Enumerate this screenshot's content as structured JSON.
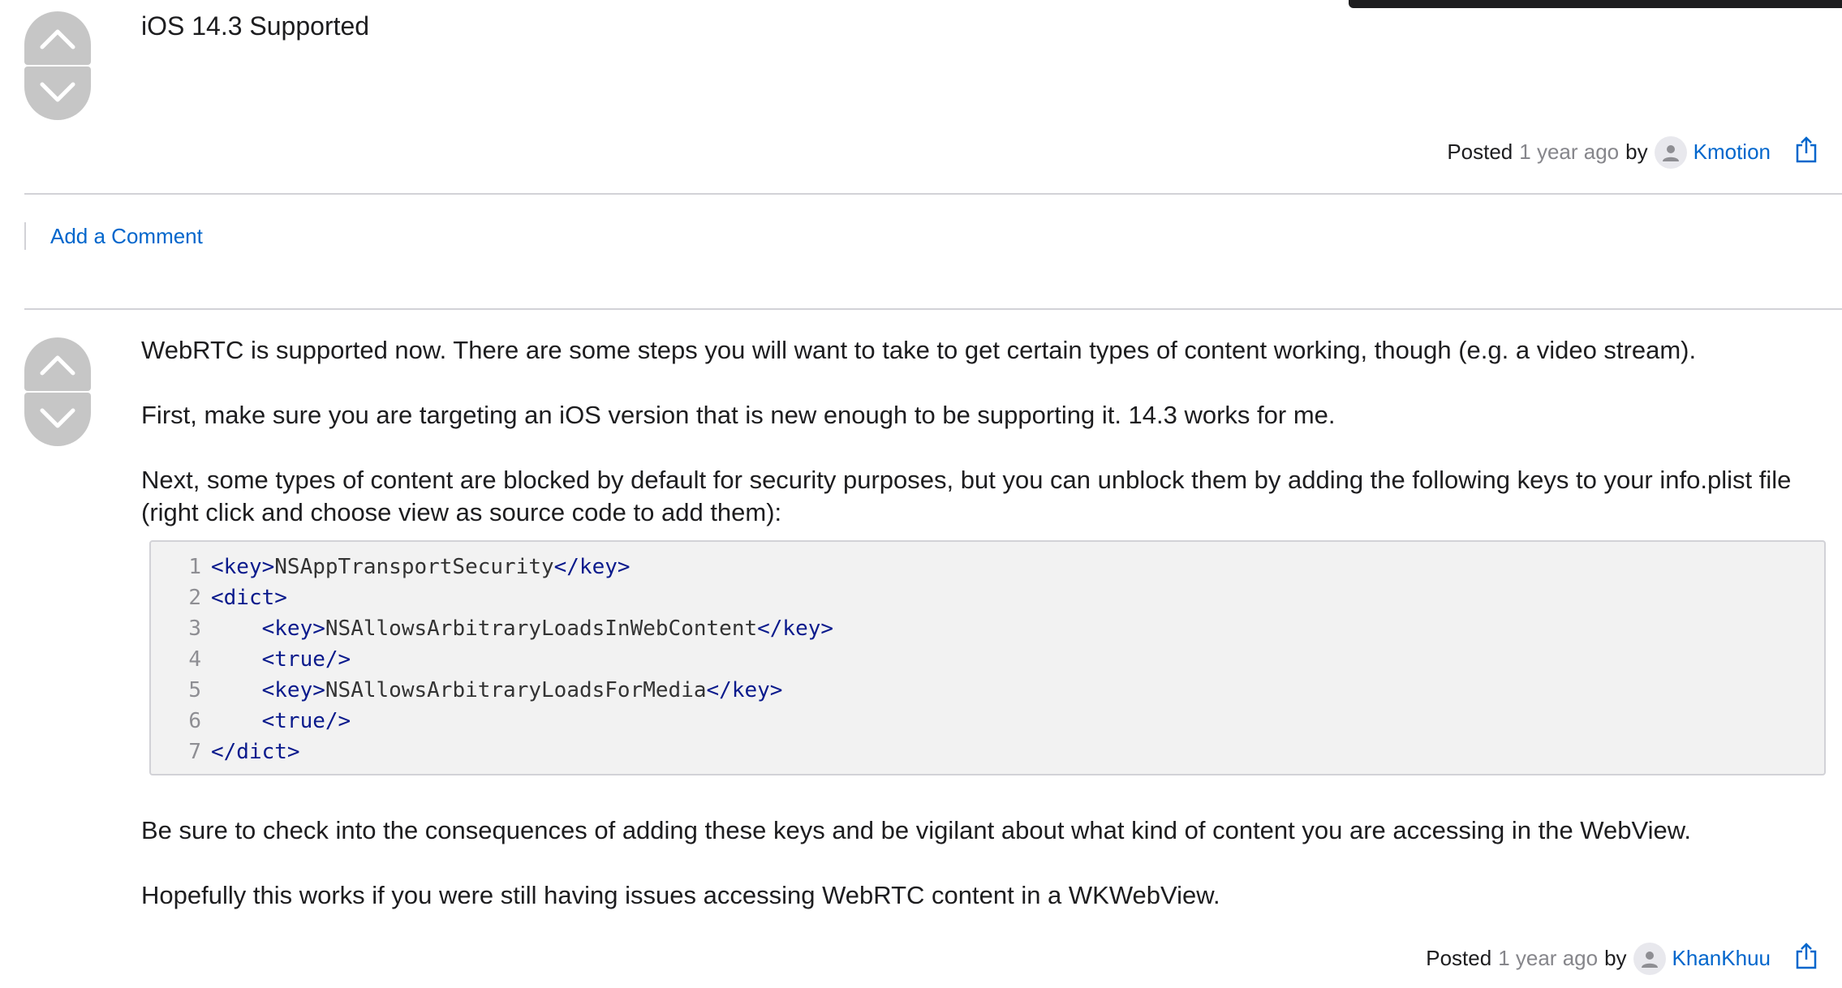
{
  "question": {
    "title": "iOS 14.3 Supported"
  },
  "question_meta": {
    "posted_label": "Posted",
    "time": "1 year ago",
    "by_label": "by",
    "user": "Kmotion"
  },
  "comments": {
    "add_label": "Add a Comment"
  },
  "answer": {
    "paragraphs": [
      "WebRTC is supported now. There are some steps you will want to take to get certain types of content working, though (e.g. a video stream).",
      "First, make sure you are targeting an iOS version that is new enough to be supporting it. 14.3 works for me.",
      "Next, some types of content are blocked by default for security purposes, but you can unblock them by adding the following keys to your info.plist file (right click and choose view as source code to add them):",
      "Be sure to check into the consequences of adding these keys and be vigilant about what kind of content you are accessing in the WebView.",
      "Hopefully this works if you were still having issues accessing WebRTC content in a WKWebView."
    ],
    "code_lines": [
      {
        "num": "1",
        "indent": "",
        "open": "<key>",
        "text": "NSAppTransportSecurity",
        "close": "</key>"
      },
      {
        "num": "2",
        "indent": "",
        "open": "<dict>",
        "text": "",
        "close": ""
      },
      {
        "num": "3",
        "indent": "    ",
        "open": "<key>",
        "text": "NSAllowsArbitraryLoadsInWebContent",
        "close": "</key>"
      },
      {
        "num": "4",
        "indent": "    ",
        "open": "<true/>",
        "text": "",
        "close": ""
      },
      {
        "num": "5",
        "indent": "    ",
        "open": "<key>",
        "text": "NSAllowsArbitraryLoadsForMedia",
        "close": "</key>"
      },
      {
        "num": "6",
        "indent": "    ",
        "open": "<true/>",
        "text": "",
        "close": ""
      },
      {
        "num": "7",
        "indent": "",
        "open": "</dict>",
        "text": "",
        "close": ""
      }
    ]
  },
  "answer_meta": {
    "posted_label": "Posted",
    "time": "1 year ago",
    "by_label": "by",
    "user": "KhanKhuu"
  },
  "icons": {
    "upvote": "chevron-up-icon",
    "downvote": "chevron-down-icon",
    "avatar": "user-icon",
    "share": "share-icon"
  },
  "colors": {
    "link": "#0066cc",
    "vote_bg": "#c6c6c6",
    "code_tag": "#0a1a8c",
    "muted": "#86868b"
  }
}
